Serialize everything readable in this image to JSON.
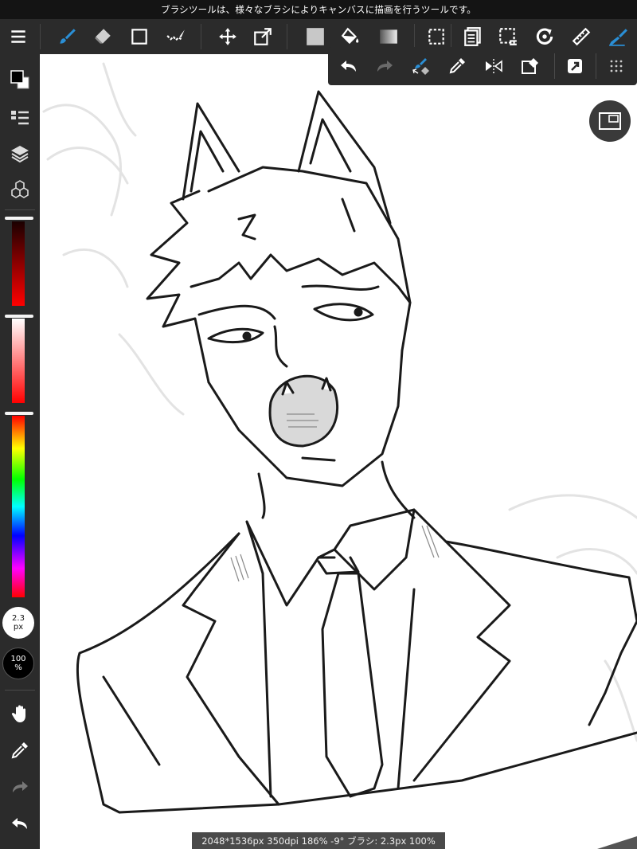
{
  "tip": "ブラシツールは、様々なブラシによりキャンバスに描画を行うツールです。",
  "status": "2048*1536px 350dpi 186% -9° ブラシ: 2.3px 100%",
  "brush": {
    "size_value": "2.3",
    "size_unit": "px",
    "opacity_value": "100",
    "opacity_unit": "%"
  },
  "color_sliders": {
    "hue_red_level": 0.0,
    "value_level": 0.0,
    "saturation_level": 0.0
  },
  "colors": {
    "ui_dark": "#2b2b2b",
    "accent_blue": "#1e88c9",
    "foreground": "#000000",
    "background": "#ffffff"
  },
  "toolbar_icons": [
    "menu-icon",
    "brush-icon",
    "eraser-icon",
    "rectangle-icon",
    "select-pen-icon",
    "move-icon",
    "transform-icon",
    "fill-color-icon",
    "bucket-icon",
    "gradient-icon",
    "select-rect-icon",
    "layer-list-icon",
    "select-clear-icon",
    "rotate-icon",
    "ruler-icon",
    "pen-icon"
  ],
  "float_icons": [
    "undo-icon",
    "redo-icon",
    "brush-eraser-swap-icon",
    "eyedropper-icon",
    "flip-icon",
    "clear-icon",
    "snap-icon",
    "grid-icon"
  ]
}
